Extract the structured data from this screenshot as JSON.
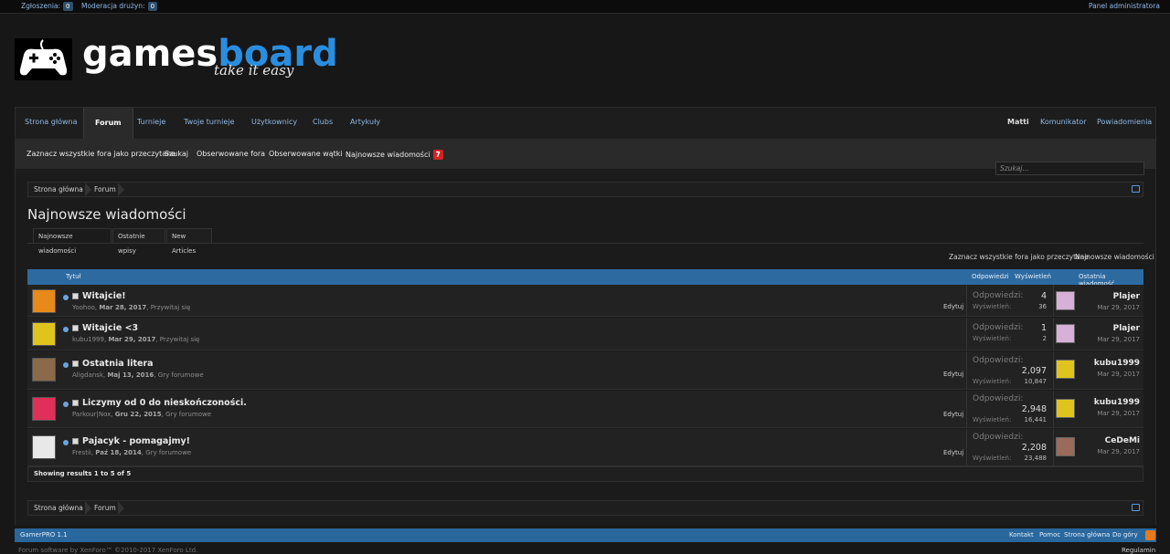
{
  "adminbar": {
    "reports_label": "Zgłoszenia:",
    "reports_count": "0",
    "team_mod_label": "Moderacja drużyn:",
    "team_mod_count": "0",
    "admin_panel": "Panel administratora"
  },
  "logo": {
    "word_games": "games",
    "word_board": "board",
    "tagline": "take it easy"
  },
  "nav": {
    "tabs": [
      "Strona główna",
      "Forum",
      "Turnieje",
      "Twoje turnieje",
      "Użytkownicy",
      "Clubs",
      "Artykuły"
    ],
    "active": "Forum",
    "user": "Matti",
    "messenger": "Komunikator",
    "notifications": "Powiadomienia"
  },
  "subnav": {
    "mark_read": "Zaznacz wszystkie fora jako przeczytane",
    "search": "Szukaj",
    "watched_forums": "Obserwowane fora",
    "watched_threads": "Obserwowane wątki",
    "new_posts": "Najnowsze wiadomości",
    "new_posts_badge": "7"
  },
  "search": {
    "placeholder": "Szukaj..."
  },
  "breadcrumb": [
    "Strona główna",
    "Forum"
  ],
  "page": {
    "title": "Najnowsze wiadomości",
    "tabs": [
      "Najnowsze wiadomości",
      "Ostatnie wpisy",
      "New Articles"
    ],
    "links_right": [
      "Zaznacz wszystkie fora jako przeczytane",
      "Najnowsze wiadomości"
    ]
  },
  "table": {
    "headers": {
      "title": "Tytuł",
      "replies": "Odpowiedzi",
      "views": "Wyświetleń",
      "last": "Ostatnia wiadomość"
    },
    "replies_label": "Odpowiedzi:",
    "views_label": "Wyświetleń:",
    "edit_label": "Edytuj",
    "rows": [
      {
        "title": "Witajcie!",
        "author": "Yoohoo",
        "date": "Mar 28, 2017",
        "forum": "Przywitaj się",
        "replies": "4",
        "views": "36",
        "last_user": "Plajer",
        "last_date": "Mar 29, 2017",
        "avatar_color": "#e88a1a",
        "last_avatar_color": "#d6b0d6"
      },
      {
        "title": "Witajcie <3",
        "author": "kubu1999",
        "date": "Mar 29, 2017",
        "forum": "Przywitaj się",
        "replies": "1",
        "views": "2",
        "last_user": "Plajer",
        "last_date": "Mar 29, 2017",
        "avatar_color": "#e0c41e",
        "last_avatar_color": "#d6b0d6"
      },
      {
        "title": "Ostatnia litera",
        "author": "Aligdansk",
        "date": "Maj 13, 2016",
        "forum": "Gry forumowe",
        "replies": "2,097",
        "views": "10,847",
        "last_user": "kubu1999",
        "last_date": "Mar 29, 2017",
        "avatar_color": "#8a6a4a",
        "last_avatar_color": "#e0c41e"
      },
      {
        "title": "Liczymy od 0 do nieskończoności.",
        "author": "Parkour|Nox",
        "date": "Gru 22, 2015",
        "forum": "Gry forumowe",
        "replies": "2,948",
        "views": "16,441",
        "last_user": "kubu1999",
        "last_date": "Mar 29, 2017",
        "avatar_color": "#e0305a",
        "last_avatar_color": "#e0c41e"
      },
      {
        "title": "Pajacyk - pomagajmy!",
        "author": "Frestii",
        "date": "Paź 18, 2014",
        "forum": "Gry forumowe",
        "replies": "2,208",
        "views": "23,488",
        "last_user": "CeDeMi",
        "last_date": "Mar 29, 2017",
        "avatar_color": "#e8e8e8",
        "last_avatar_color": "#9a6a5a"
      }
    ],
    "showing": "Showing results 1 to 5 of 5"
  },
  "footer": {
    "style": "GamerPRO 1.1",
    "links": [
      "Kontakt",
      "Pomoc",
      "Strona główna",
      "Do góry"
    ],
    "copyright": "Forum software by XenForo™ ©2010-2017 XenForo Ltd.",
    "rules": "Regulamin"
  },
  "colors": {
    "accent": "#2d6aa0",
    "link": "#8fb9e6",
    "badge": "#d42323"
  }
}
